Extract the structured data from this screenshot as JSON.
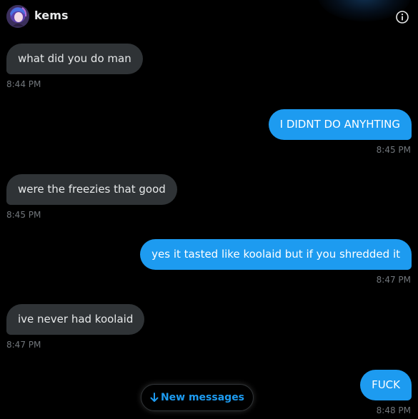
{
  "header": {
    "name": "kems",
    "avatar_icon": "avatar-image",
    "info_icon": "info-icon"
  },
  "colors": {
    "background": "#000000",
    "incoming_bubble": "#2f3336",
    "outgoing_bubble": "#1d9bf0",
    "timestamp": "#71767b",
    "accent": "#1d9bf0"
  },
  "messages": [
    {
      "direction": "in",
      "text": "what did you do man",
      "time": "8:44 PM"
    },
    {
      "direction": "out",
      "text": "I DIDNT DO ANYHTING",
      "time": "8:45 PM"
    },
    {
      "direction": "in",
      "text": "were the freezies that good",
      "time": "8:45 PM"
    },
    {
      "direction": "out",
      "text": "yes it tasted like koolaid but if you shredded it",
      "time": "8:47 PM"
    },
    {
      "direction": "in",
      "text": "ive never had koolaid",
      "time": "8:47 PM"
    },
    {
      "direction": "out",
      "text": "FUCK",
      "time": "8:48 PM"
    }
  ],
  "new_messages": {
    "label": "New messages",
    "icon": "arrow-down-icon"
  }
}
